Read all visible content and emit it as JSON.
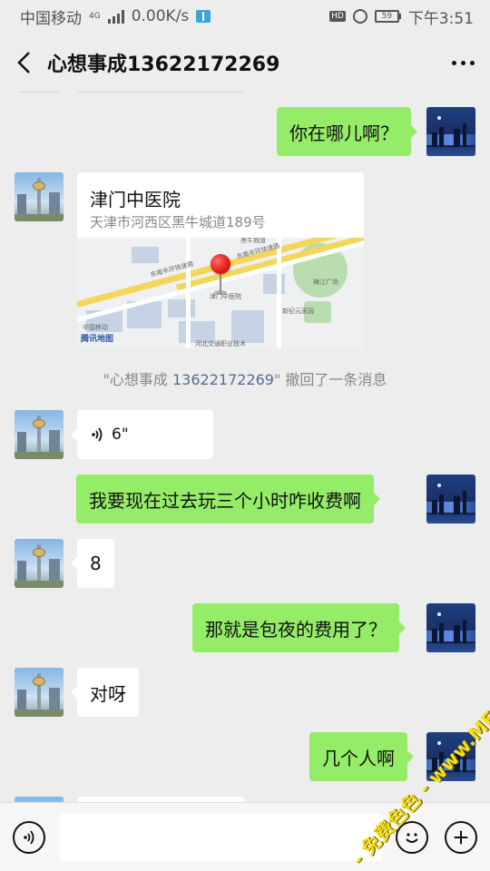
{
  "status_bar": {
    "carrier": "中国移动",
    "network_type": "4G",
    "speed": "0.00K/s",
    "hd_label": "HD",
    "battery_level": "59",
    "time": "下午3:51"
  },
  "nav": {
    "title": "心想事成13622172269"
  },
  "messages": [
    {
      "side": "out",
      "type": "text",
      "text": "你在哪儿啊？"
    },
    {
      "side": "in",
      "type": "location",
      "name": "津门中医院",
      "address": "天津市河西区黑牛城道189号"
    },
    {
      "side": "system",
      "type": "recall",
      "quote_open": "\"心想事成 ",
      "nickname": "13622172269",
      "quote_close": "\"",
      "text": " 撤回了一条消息"
    },
    {
      "side": "in",
      "type": "voice",
      "duration": "6\""
    },
    {
      "side": "out",
      "type": "text",
      "text": "我要现在过去玩三个小时咋收费啊"
    },
    {
      "side": "in",
      "type": "text",
      "text": "8"
    },
    {
      "side": "out",
      "type": "text",
      "text": "那就是包夜的费用了？"
    },
    {
      "side": "in",
      "type": "text",
      "text": "对呀"
    },
    {
      "side": "out",
      "type": "text",
      "text": "几个人啊"
    }
  ],
  "map": {
    "labels": {
      "road_1": "东南半环快速路",
      "road_2": "东南半环快速路",
      "road_3": "黑牛城道",
      "hospital": "津门中医院",
      "park_1": "梅江广场",
      "park_2": "新纪元家园",
      "mobile": "中国移动",
      "school": "河北交通职业技术",
      "provider": "腾讯地图"
    }
  },
  "input_bar": {
    "placeholder": ""
  },
  "watermark": {
    "text": "- 免费色色 - www.MFsese.com"
  },
  "colors": {
    "incoming_bubble": "#ffffff",
    "outgoing_bubble": "#95ec69",
    "background": "#ededed",
    "link": "#576b95"
  }
}
